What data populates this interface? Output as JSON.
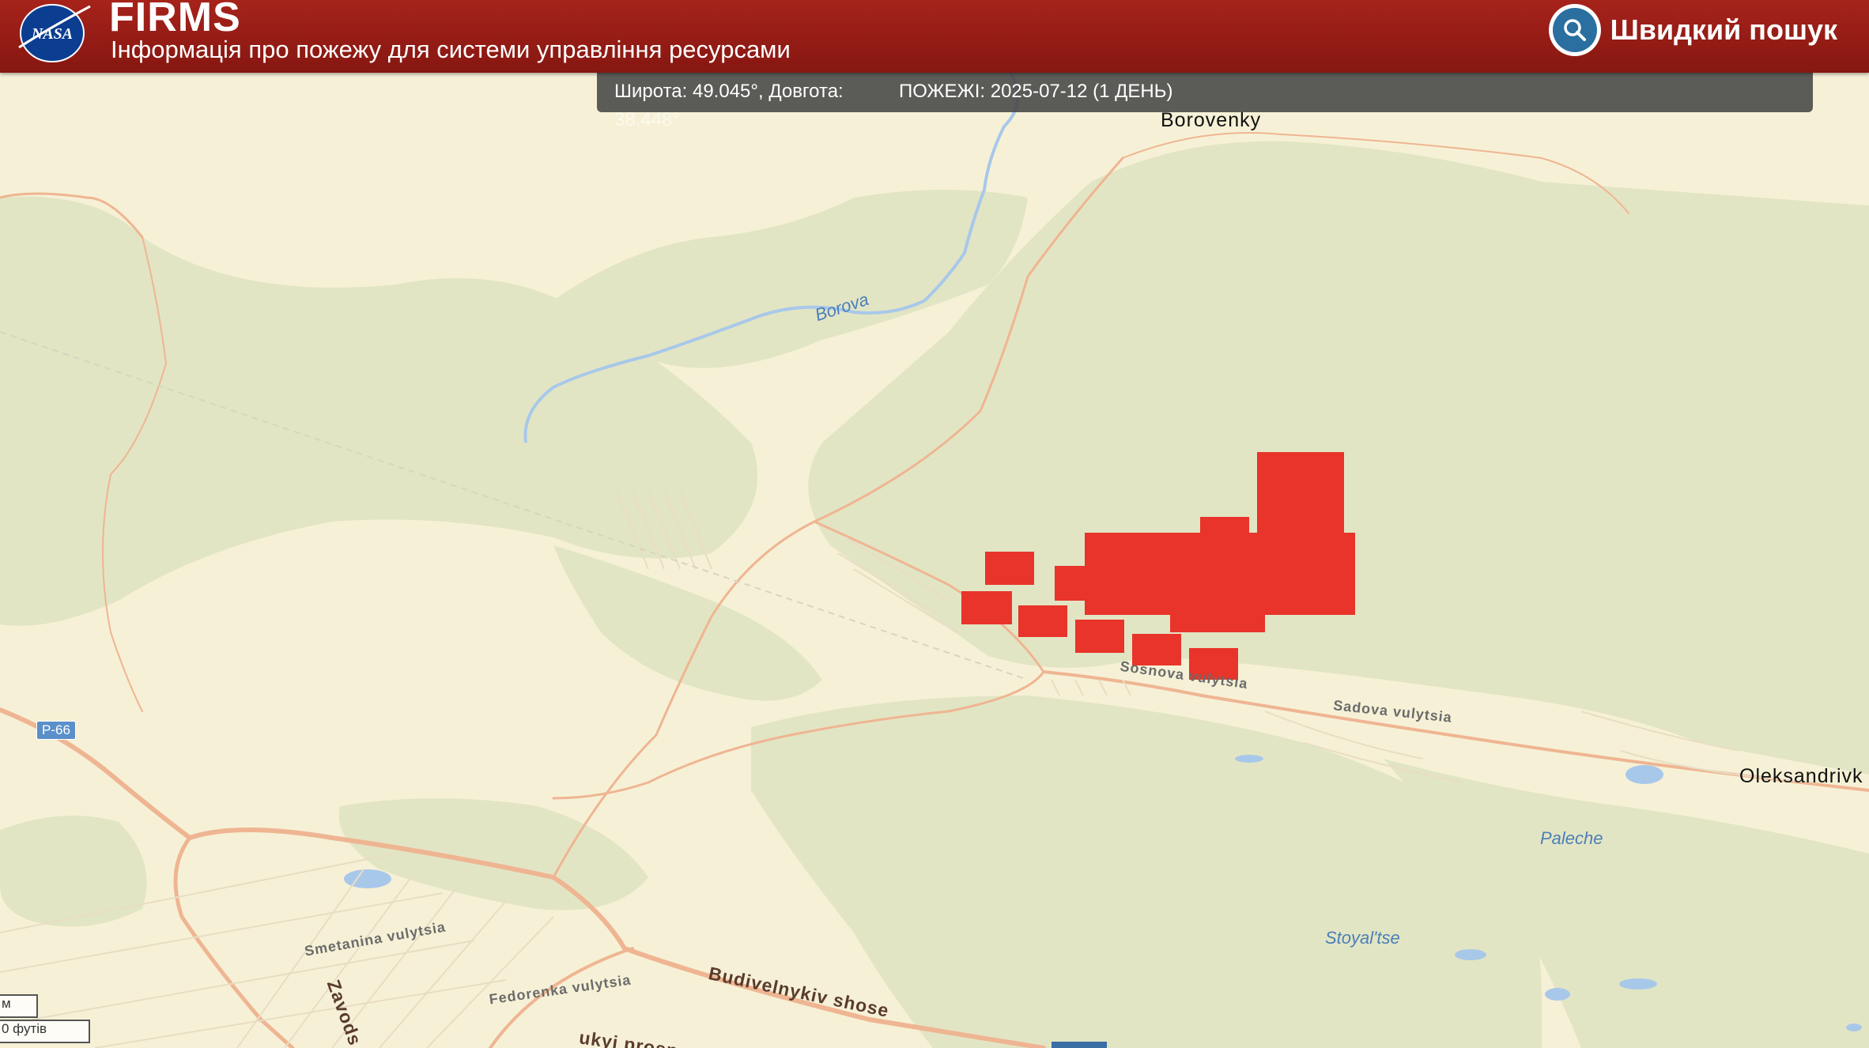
{
  "header": {
    "logo_text": "NASA",
    "title": "FIRMS",
    "subtitle": "Інформація про пожежу для системи управління ресурсами",
    "search_label": "Швидкий пошук"
  },
  "info_bar": {
    "lat_text": "Широта: 49.045°, Довгота:",
    "lon_text": "38.448°",
    "fires_text": "ПОЖЕЖІ: 2025-07-12 (1 ДЕНЬ)"
  },
  "map": {
    "places": {
      "borovenky": "Borovenky",
      "oleksandrivka": "Oleksandrivk",
      "paleche": "Paleche",
      "stoyaltse": "Stoyal'tse",
      "borova": "Borova"
    },
    "streets": {
      "sosnova": "Sosnova vulytsia",
      "sadova": "Sadova vulytsia",
      "smetanina": "Smetanina vulytsia",
      "fedorenka": "Fedorenka vulytsia",
      "budivelnykiv": "Budivelnykiv shose",
      "zavods": "Zavods",
      "ukyi": "ukyi prosp"
    },
    "route_shield": "P-66",
    "scale": {
      "metric": "м",
      "imperial": "0 футів"
    },
    "colors": {
      "fire": "#e8342a",
      "forest": "#e2e5c4",
      "land": "#f6f1d6",
      "water": "#a8c8ea",
      "road": "#efb592"
    }
  }
}
